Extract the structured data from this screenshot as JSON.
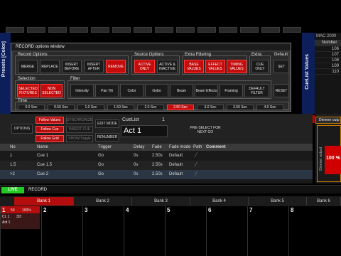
{
  "mac_panel": {
    "title": "MAC 2000",
    "header": "Number",
    "rows": [
      "106",
      "107",
      "108",
      "109",
      "110"
    ]
  },
  "presets_label": "Presets [Color]",
  "cuelist_values_label": "CueList Values",
  "record_window": {
    "title": "RECORD options window",
    "record_options": {
      "label": "Record Options",
      "buttons": [
        "MERGE",
        "REPLACE",
        "INSERT BEFORE",
        "INSERT AFTER",
        "REMOVE"
      ],
      "active": "REMOVE"
    },
    "source_options": {
      "label": "Source Options",
      "buttons": [
        "ACTIVE ONLY",
        "ACTIVE & INACTIVE"
      ],
      "active": "ACTIVE ONLY"
    },
    "extra_filtering": {
      "label": "Extra Filtering",
      "buttons": [
        "BASE VALUES",
        "EFFECT VALUES",
        "TIMING VALUES"
      ],
      "active": [
        "BASE VALUES",
        "EFFECT VALUES",
        "TIMING VALUES"
      ]
    },
    "extra": {
      "label": "Extra",
      "buttons": [
        "CUE ONLY"
      ]
    },
    "default": {
      "label": "Default",
      "buttons": [
        "SET"
      ]
    },
    "selection": {
      "label": "Selection",
      "buttons": [
        "SELECTED FIXTURES",
        "NON SELECTED"
      ],
      "active": [
        "SELECTED FIXTURES",
        "NON SELECTED"
      ]
    },
    "filter": {
      "label": "Filter",
      "buttons": [
        "Intensity",
        "Pan Tilt",
        "Color",
        "Gobo",
        "Beam",
        "Beam Effects",
        "Framing",
        "DEFAULT FILTER"
      ]
    },
    "reset_label": "RESET",
    "time": {
      "label": "Time",
      "buttons": [
        "0.0 Sec",
        "0.50 Sec",
        "1.0 Sec",
        "1.50 Sec",
        "2.0 Sec",
        "2.50 Sec",
        "3.0 Sec",
        "3.50 Sec",
        "4.0 Sec"
      ],
      "active": "2.50 Sec"
    }
  },
  "cue_toolbar": {
    "options": "OPTIONS",
    "follow_values": "Follow Values",
    "follow_cue": "Follow Cue",
    "follow_grid": "Follow Grid",
    "dim1": "SYNCHRONIZE",
    "dim2": "INSERT CUE",
    "dim3": "SHOW/Toggle",
    "edit_mode": "EDIT MODE",
    "renumber": "RENUMBER",
    "cuelist_label": "CueList",
    "cuelist_number": "1",
    "cuelist_name": "Act 1",
    "preselect": "PRE-SELECT FOR NEXT GO"
  },
  "cue_table": {
    "headers": [
      "No",
      "Name",
      "Trigger",
      "Delay",
      "Fade",
      "Fade mode",
      "Path",
      "Comment"
    ],
    "rows": [
      {
        "no": "1",
        "name": "Cue 1",
        "trigger": "Go",
        "delay": "0s",
        "fade": "2.50s",
        "mode": "Default"
      },
      {
        "no": "1.5",
        "name": "Cue 1.5",
        "trigger": "Go",
        "delay": "0s",
        "fade": "2.50s",
        "mode": "Default"
      },
      {
        "no": ">2",
        "name": "Cue 2",
        "trigger": "Go",
        "delay": "0s",
        "fade": "2.50s",
        "mode": "Default"
      }
    ]
  },
  "dimmer": {
    "title": "Dimmer outp",
    "value": "100 %",
    "side": "Dimmer output"
  },
  "live_bar": {
    "live": "LIVE",
    "record": "RECORD"
  },
  "banks": [
    "Bank 1",
    "Bank 2",
    "Bank 3",
    "Bank 4",
    "Bank 5",
    "Bank 6"
  ],
  "faders": {
    "numbers": [
      "1",
      "2",
      "3",
      "4",
      "5",
      "6",
      "7",
      "8"
    ],
    "f1_pct": "100%",
    "f1_50": "50",
    "f1_cl": "CL 1",
    "f1_count": "3/3",
    "f1_name": "Act 1"
  }
}
